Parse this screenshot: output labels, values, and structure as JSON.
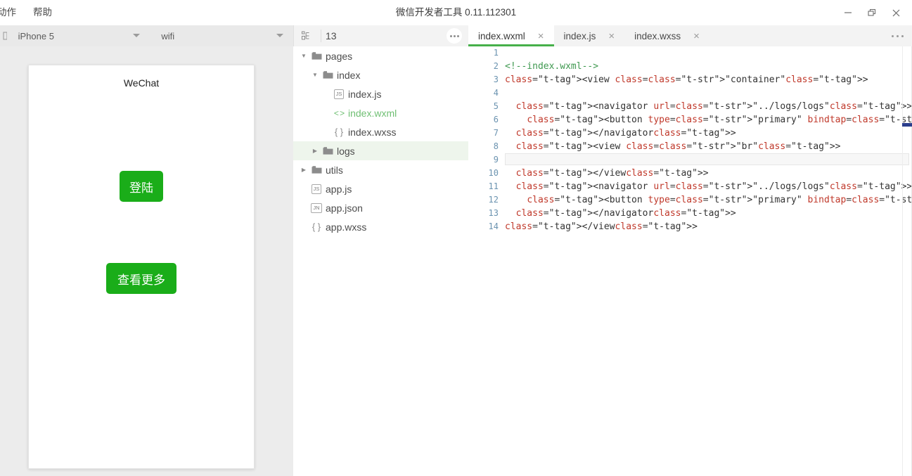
{
  "window": {
    "title": "微信开发者工具 0.11.112301",
    "menus": [
      "动作",
      "帮助"
    ],
    "controls": {
      "minimize": "minimize-icon",
      "restore": "restore-icon",
      "close": "close-icon"
    }
  },
  "toolbar": {
    "device_select": "iPhone 5",
    "network_select": "wifi",
    "project_name": "13",
    "tree_icon": "hierarchy-icon",
    "overflow": "…"
  },
  "simulator": {
    "page_title": "WeChat",
    "buttons": [
      {
        "label": "登陆",
        "color": "#1aad19",
        "name": "login-button"
      },
      {
        "label": "查看更多",
        "color": "#1aad19",
        "name": "view-more-button"
      }
    ]
  },
  "file_tree": [
    {
      "label": "pages",
      "indent": 0,
      "type": "folder",
      "expanded": true,
      "selected": false
    },
    {
      "label": "index",
      "indent": 1,
      "type": "folder",
      "expanded": true,
      "selected": false
    },
    {
      "label": "index.js",
      "indent": 2,
      "type": "js",
      "expanded": null,
      "selected": false
    },
    {
      "label": "index.wxml",
      "indent": 2,
      "type": "wxml",
      "expanded": null,
      "selected": false
    },
    {
      "label": "index.wxss",
      "indent": 2,
      "type": "wxss",
      "expanded": null,
      "selected": false
    },
    {
      "label": "logs",
      "indent": 1,
      "type": "folder",
      "expanded": false,
      "selected": true
    },
    {
      "label": "utils",
      "indent": 0,
      "type": "folder",
      "expanded": false,
      "selected": false
    },
    {
      "label": "app.js",
      "indent": 0,
      "type": "js",
      "expanded": null,
      "selected": false
    },
    {
      "label": "app.json",
      "indent": 0,
      "type": "json",
      "expanded": null,
      "selected": false
    },
    {
      "label": "app.wxss",
      "indent": 0,
      "type": "wxss",
      "expanded": null,
      "selected": false
    }
  ],
  "editor": {
    "tabs": [
      {
        "label": "index.wxml",
        "active": true,
        "close": "×"
      },
      {
        "label": "index.js",
        "active": false,
        "close": "×"
      },
      {
        "label": "index.wxss",
        "active": false,
        "close": "×"
      }
    ],
    "overflow": "…",
    "active_line": 9,
    "lines": [
      {
        "n": 1,
        "text": ""
      },
      {
        "n": 2,
        "text": "<!--index.wxml-->"
      },
      {
        "n": 3,
        "text": "<view class=\"container\">"
      },
      {
        "n": 4,
        "text": ""
      },
      {
        "n": 5,
        "text": "  <navigator url=\"../logs/logs\">"
      },
      {
        "n": 6,
        "text": "    <button type=\"primary\" bindtap=\"logbtn\"> 登陆 </button>"
      },
      {
        "n": 7,
        "text": "  </navigator>"
      },
      {
        "n": 8,
        "text": "  <view class=\"br\">"
      },
      {
        "n": 9,
        "text": ""
      },
      {
        "n": 10,
        "text": "  </view>"
      },
      {
        "n": 11,
        "text": "  <navigator url=\"../logs/logs\">"
      },
      {
        "n": 12,
        "text": "    <button type=\"primary\" bindtap=\"morebtn\"> 查看更多 </button>"
      },
      {
        "n": 13,
        "text": "  </navigator>"
      },
      {
        "n": 14,
        "text": "</view>"
      }
    ]
  },
  "colors": {
    "accent_green": "#46b04a",
    "wechat_green": "#1aad19",
    "selection": "#eef5ec",
    "toolbar_bg": "#f3f3f3",
    "sim_bg": "#ececec"
  }
}
